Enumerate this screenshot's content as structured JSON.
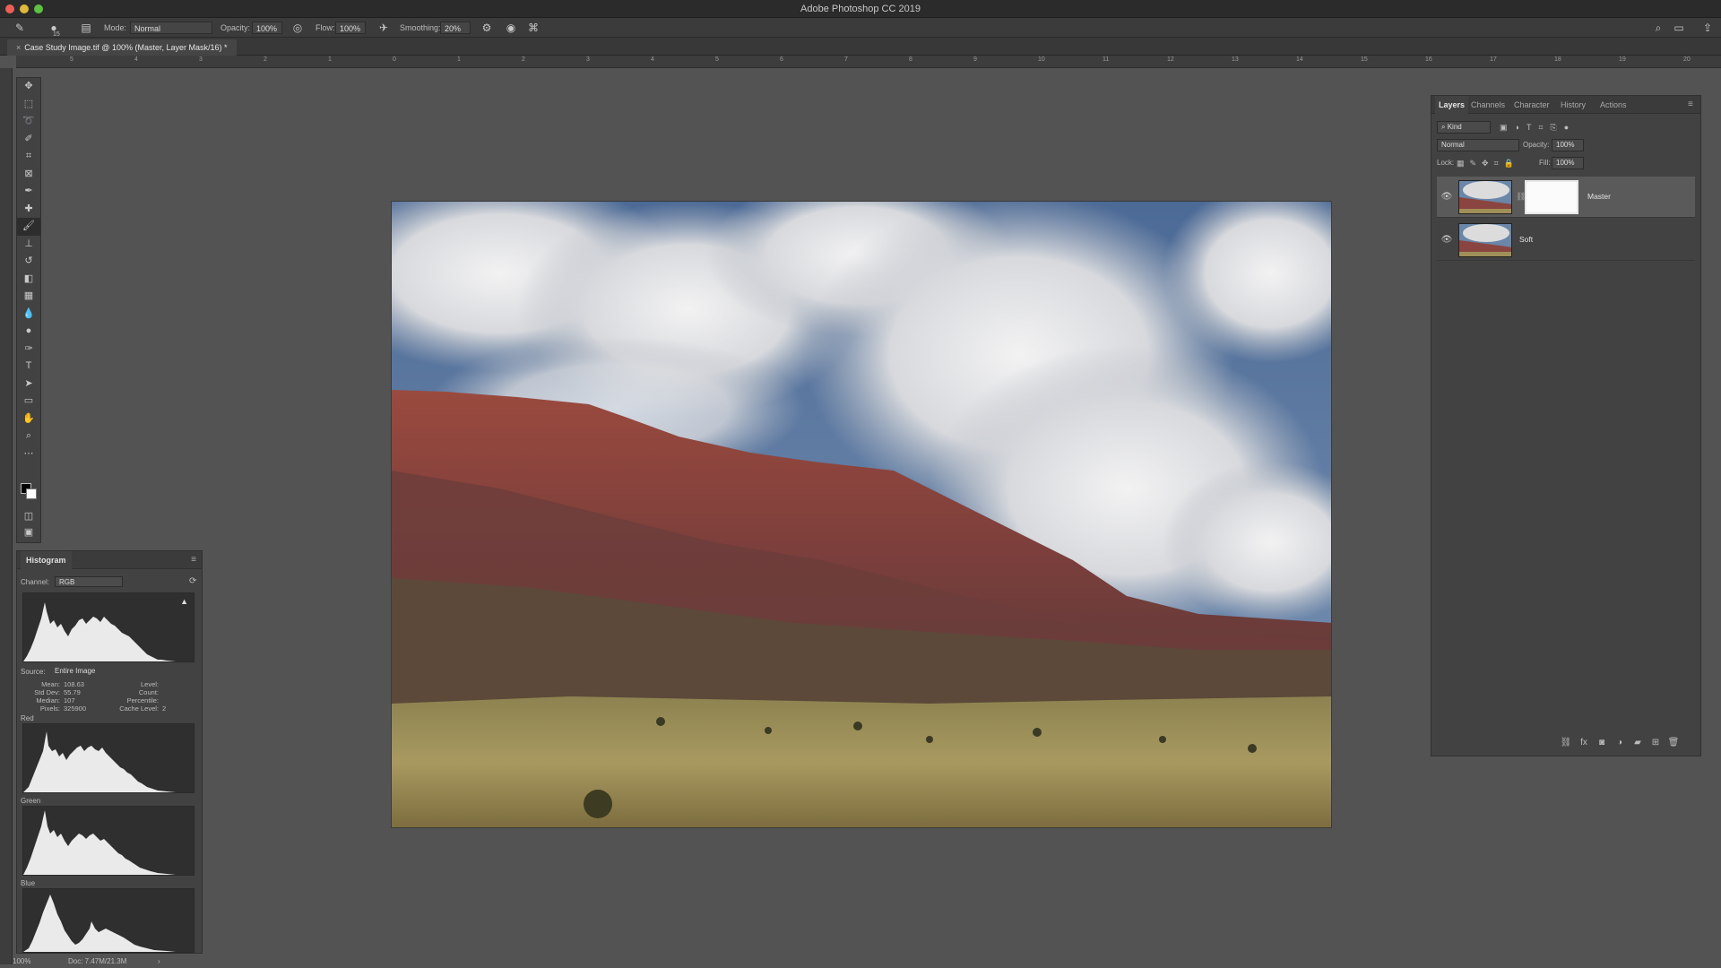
{
  "app": {
    "title": "Adobe Photoshop CC 2019"
  },
  "options": {
    "mode_label": "Mode:",
    "mode_value": "Normal",
    "opacity_label": "Opacity:",
    "opacity_value": "100%",
    "flow_label": "Flow:",
    "flow_value": "100%",
    "smoothing_label": "Smoothing:",
    "smoothing_value": "20%",
    "brush_size": "15"
  },
  "document": {
    "tab_title": "Case Study Image.tif @ 100% (Master, Layer Mask/16) *"
  },
  "rulers": {
    "top_ticks": [
      "5",
      "4",
      "3",
      "2",
      "1",
      "0",
      "1",
      "2",
      "3",
      "4",
      "5",
      "6",
      "7",
      "8",
      "9",
      "10",
      "11",
      "12",
      "13",
      "14",
      "15",
      "16",
      "17",
      "18",
      "19",
      "20"
    ]
  },
  "histogram": {
    "title": "Histogram",
    "channel_label": "Channel:",
    "channel_value": "RGB",
    "source_label": "Source:",
    "source_value": "Entire Image",
    "stats": {
      "mean_label": "Mean:",
      "mean": "108.63",
      "stddev_label": "Std Dev:",
      "stddev": "55.79",
      "median_label": "Median:",
      "median": "107",
      "pixels_label": "Pixels:",
      "pixels": "325900",
      "level_label": "Level:",
      "level": "",
      "count_label": "Count:",
      "count": "",
      "percentile_label": "Percentile:",
      "percentile": "",
      "cache_label": "Cache Level:",
      "cache": "2"
    },
    "channels": [
      "Red",
      "Green",
      "Blue"
    ]
  },
  "layers_panel": {
    "tabs": [
      "Layers",
      "Channels",
      "Character",
      "History",
      "Actions"
    ],
    "active_tab": "Layers",
    "filter_label": "Kind",
    "blend_mode": "Normal",
    "opacity_label": "Opacity:",
    "opacity": "100%",
    "lock_label": "Lock:",
    "fill_label": "Fill:",
    "fill": "100%",
    "layers": [
      {
        "name": "Master",
        "selected": true,
        "has_mask": true
      },
      {
        "name": "Soft",
        "selected": false,
        "has_mask": false
      }
    ]
  },
  "status": {
    "zoom": "100%",
    "doc": "Doc: 7.47M/21.3M"
  },
  "colors": {
    "bg": "#535353",
    "panel": "#424242",
    "foreground_swatch": "#000000",
    "background_swatch": "#ffffff"
  }
}
